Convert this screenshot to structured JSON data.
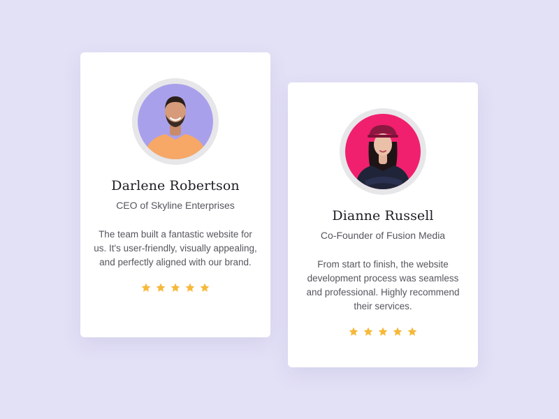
{
  "colors": {
    "background": "#e3e1f6",
    "card": "#ffffff",
    "star": "#f6b93b",
    "avatar_1_bg": "#a9a0ec",
    "avatar_2_bg": "#f0206e"
  },
  "testimonials": [
    {
      "name": "Darlene Robertson",
      "role": "CEO of Skyline Enterprises",
      "quote": "The team built a fantastic website for us. It's user-friendly, visually appealing, and perfectly aligned with our brand.",
      "rating": 5,
      "avatar": "avatar-photo"
    },
    {
      "name": "Dianne Russell",
      "role": "Co-Founder of Fusion Media",
      "quote": "From start to finish, the website development process was seamless and professional. Highly recommend their services.",
      "rating": 5,
      "avatar": "avatar-photo"
    }
  ]
}
